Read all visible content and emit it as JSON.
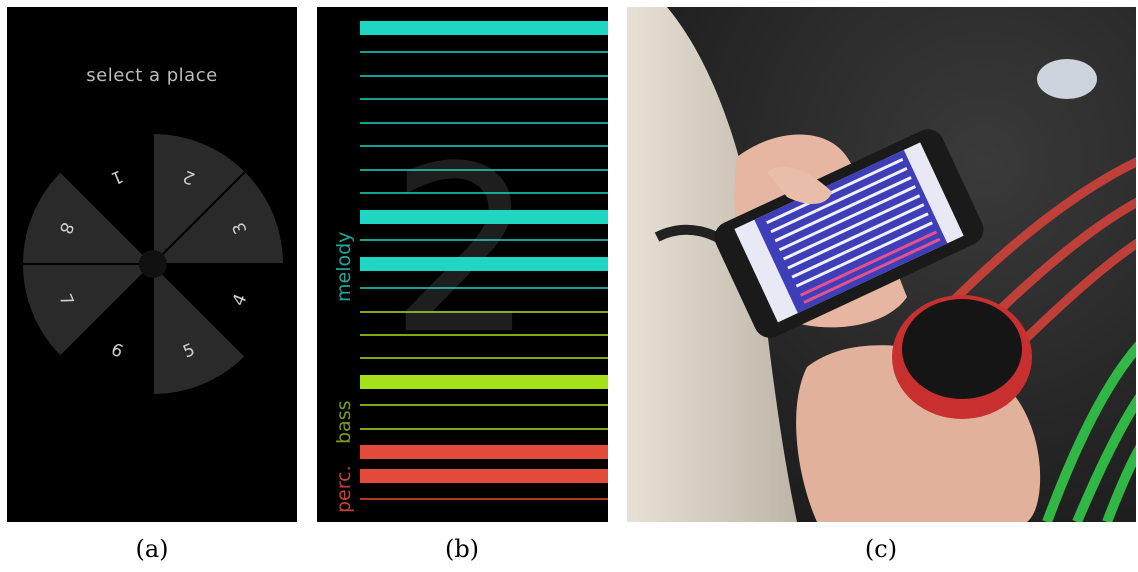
{
  "panel_a": {
    "title": "select a place",
    "sector_numbers": [
      "2",
      "3",
      "4",
      "5",
      "6",
      "7",
      "8",
      "1"
    ],
    "colors": {
      "active_sector": "#2a2a2a",
      "inactive_text": "#cfcfcf",
      "background": "#000000"
    }
  },
  "panel_b": {
    "big_number": "2",
    "sections": [
      {
        "name": "melody",
        "color": "#1fd6c2",
        "label_color": "#1aa89c"
      },
      {
        "name": "bass",
        "color": "#a6e21b",
        "label_color": "#7a9a1a"
      },
      {
        "name": "perc.",
        "color": "#e54b3b",
        "label_color": "#c24033"
      }
    ]
  },
  "captions": {
    "a": "(a)",
    "b": "(b)",
    "c": "(c)"
  }
}
